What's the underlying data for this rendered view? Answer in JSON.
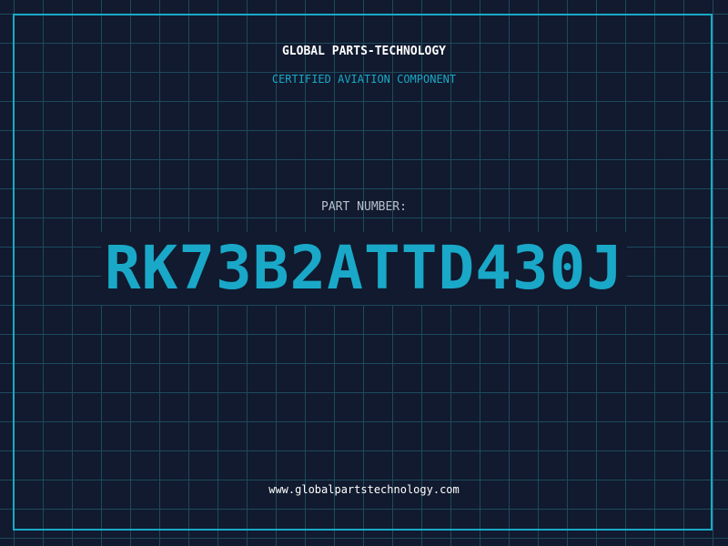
{
  "header": {
    "company_name": "GLOBAL PARTS-TECHNOLOGY",
    "subtitle": "CERTIFIED AVIATION COMPONENT"
  },
  "part": {
    "label": "PART NUMBER:",
    "number": "RK73B2ATTD430J"
  },
  "footer": {
    "website": "www.globalpartstechnology.com"
  },
  "colors": {
    "background": "#111a2e",
    "grid": "#1d4a5e",
    "accent": "#1aa8c8",
    "text": "#ffffff",
    "label": "#b8c0cc"
  }
}
